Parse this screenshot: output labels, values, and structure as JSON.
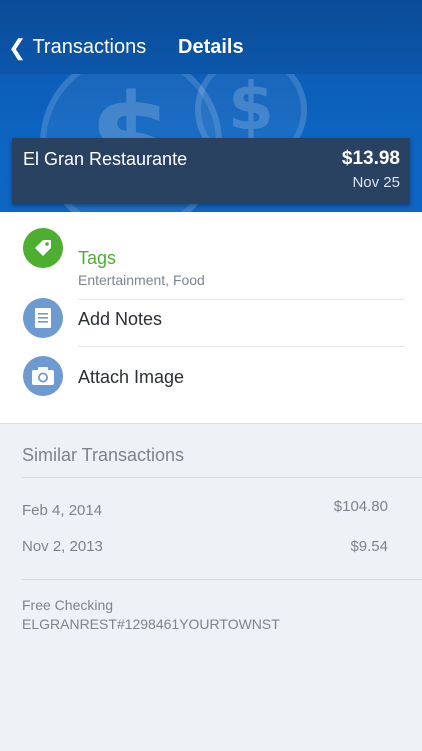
{
  "nav": {
    "back_label": "Transactions",
    "title": "Details"
  },
  "transaction": {
    "merchant": "El Gran Restaurante",
    "amount": "$13.98",
    "date": "Nov 25"
  },
  "hero": {
    "coin_symbol": "$"
  },
  "actions": [
    {
      "label": "Tags",
      "sub": "Entertainment, Food",
      "icon": "tag-icon",
      "color": "#4caf2e"
    },
    {
      "label": "Add Notes",
      "icon": "notes-icon",
      "color": "#6d9bd1"
    },
    {
      "label": "Attach Image",
      "icon": "camera-icon",
      "color": "#6d9bd1"
    }
  ],
  "similar": {
    "heading": "Similar Transactions",
    "rows": [
      {
        "date": "Feb 4, 2014",
        "amount": "$104.80"
      },
      {
        "date": "Nov 2, 2013",
        "amount": "$9.54"
      }
    ]
  },
  "account": {
    "name": "Free Checking",
    "description": "ELGRANREST#1298461YOURTOWNST"
  },
  "colors": {
    "header": "#0b56aa",
    "summary_bg": "#2a4262",
    "tag_green": "#4caf2e",
    "icon_blue": "#6d9bd1"
  }
}
